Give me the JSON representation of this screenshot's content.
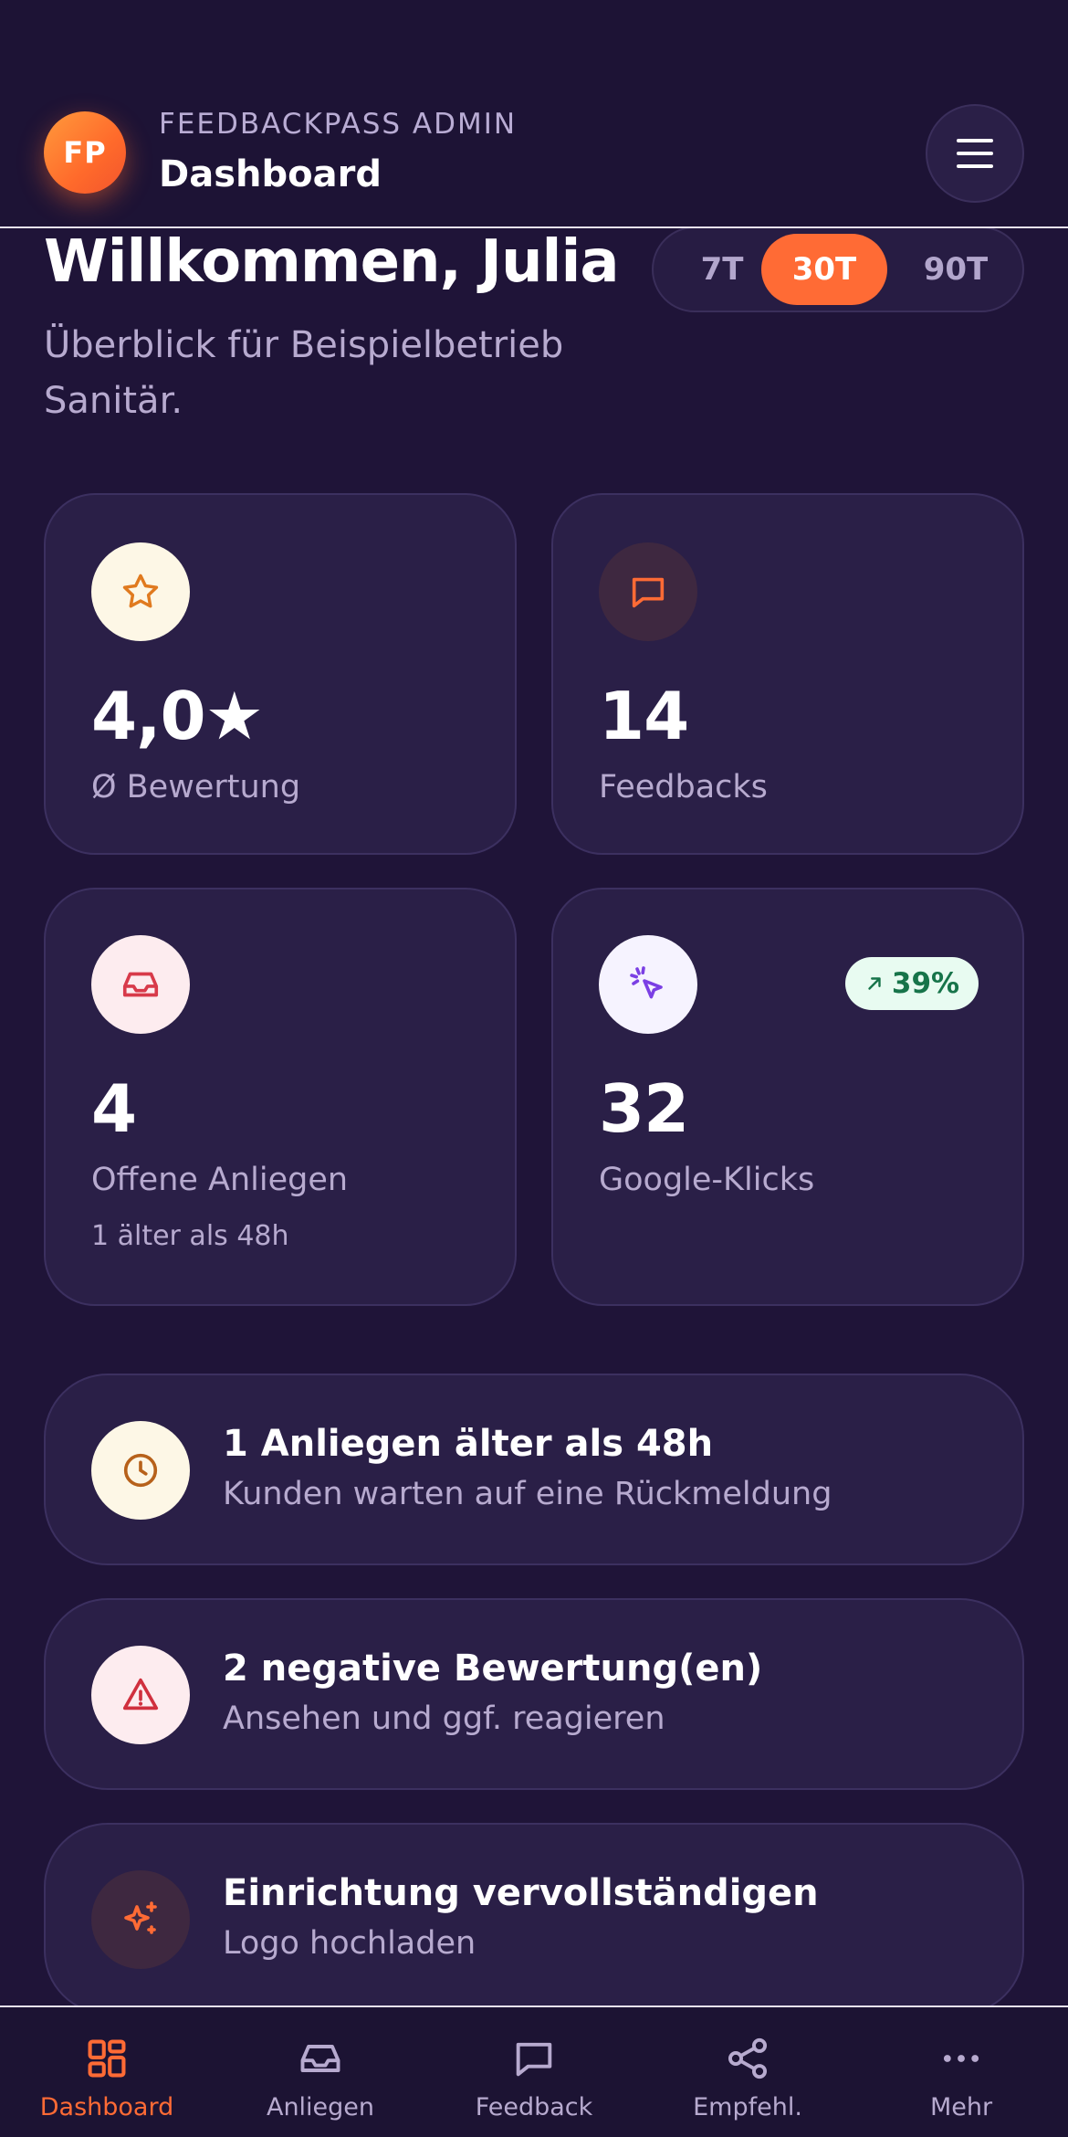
{
  "header": {
    "logo_text": "FP",
    "subtitle": "FEEDBACKPASS ADMIN",
    "title": "Dashboard",
    "menu_icon": "menu-icon"
  },
  "welcome": {
    "title": "Willkommen, Julia",
    "subtitle": "Überblick für Beispielbetrieb Sanitär."
  },
  "range": {
    "options": [
      "7T",
      "30T",
      "90T"
    ],
    "selected": "30T"
  },
  "stats": [
    {
      "icon": "star-icon",
      "value": "4,0★",
      "label": "Ø Bewertung"
    },
    {
      "icon": "message-icon",
      "value": "14",
      "label": "Feedbacks"
    },
    {
      "icon": "inbox-icon",
      "value": "4",
      "label": "Offene Anliegen",
      "note": "1 älter als 48h"
    },
    {
      "icon": "cursor-click-icon",
      "value": "32",
      "label": "Google-Klicks",
      "trend": "39%"
    }
  ],
  "alerts": [
    {
      "icon": "clock-icon",
      "title": "1 Anliegen älter als 48h",
      "subtitle": "Kunden warten auf eine Rückmeldung"
    },
    {
      "icon": "warning-icon",
      "title": "2 negative Bewertung(en)",
      "subtitle": "Ansehen und ggf. reagieren"
    },
    {
      "icon": "sparkles-icon",
      "title": "Einrichtung vervollständigen",
      "subtitle": "Logo hochladen"
    }
  ],
  "nav": [
    {
      "icon": "dashboard-icon",
      "label": "Dashboard",
      "active": true
    },
    {
      "icon": "inbox-icon",
      "label": "Anliegen"
    },
    {
      "icon": "message-icon",
      "label": "Feedback"
    },
    {
      "icon": "share-icon",
      "label": "Empfehl."
    },
    {
      "icon": "more-icon",
      "label": "Mehr"
    }
  ],
  "colors": {
    "background": "#1f1438",
    "card": "#2a1f47",
    "accent": "#ff6b35",
    "muted_text": "#b7aacf",
    "trend_bg": "#e8fbf1",
    "trend_text": "#17744a"
  }
}
